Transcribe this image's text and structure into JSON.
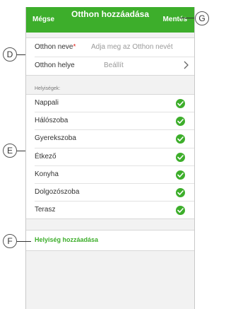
{
  "header": {
    "cancel": "Mégse",
    "title": "Otthon hozzáadása",
    "save": "Mentés"
  },
  "form": {
    "name_label": "Otthon neve",
    "name_placeholder": "Adja meg az Otthon nevét",
    "required_mark": "*",
    "location_label": "Otthon helye",
    "location_value": "Beállít"
  },
  "rooms": {
    "section_label": "Helyiségek:",
    "items": [
      {
        "label": "Nappali"
      },
      {
        "label": "Hálószoba"
      },
      {
        "label": "Gyerekszoba"
      },
      {
        "label": "Étkező"
      },
      {
        "label": "Konyha"
      },
      {
        "label": "Dolgozószoba"
      },
      {
        "label": "Terasz"
      }
    ]
  },
  "add_room": "Helyiség hozzáadása",
  "callouts": {
    "d": "D",
    "e": "E",
    "f": "F",
    "g": "G"
  },
  "colors": {
    "accent": "#3dae2b",
    "required": "#e2231a"
  }
}
